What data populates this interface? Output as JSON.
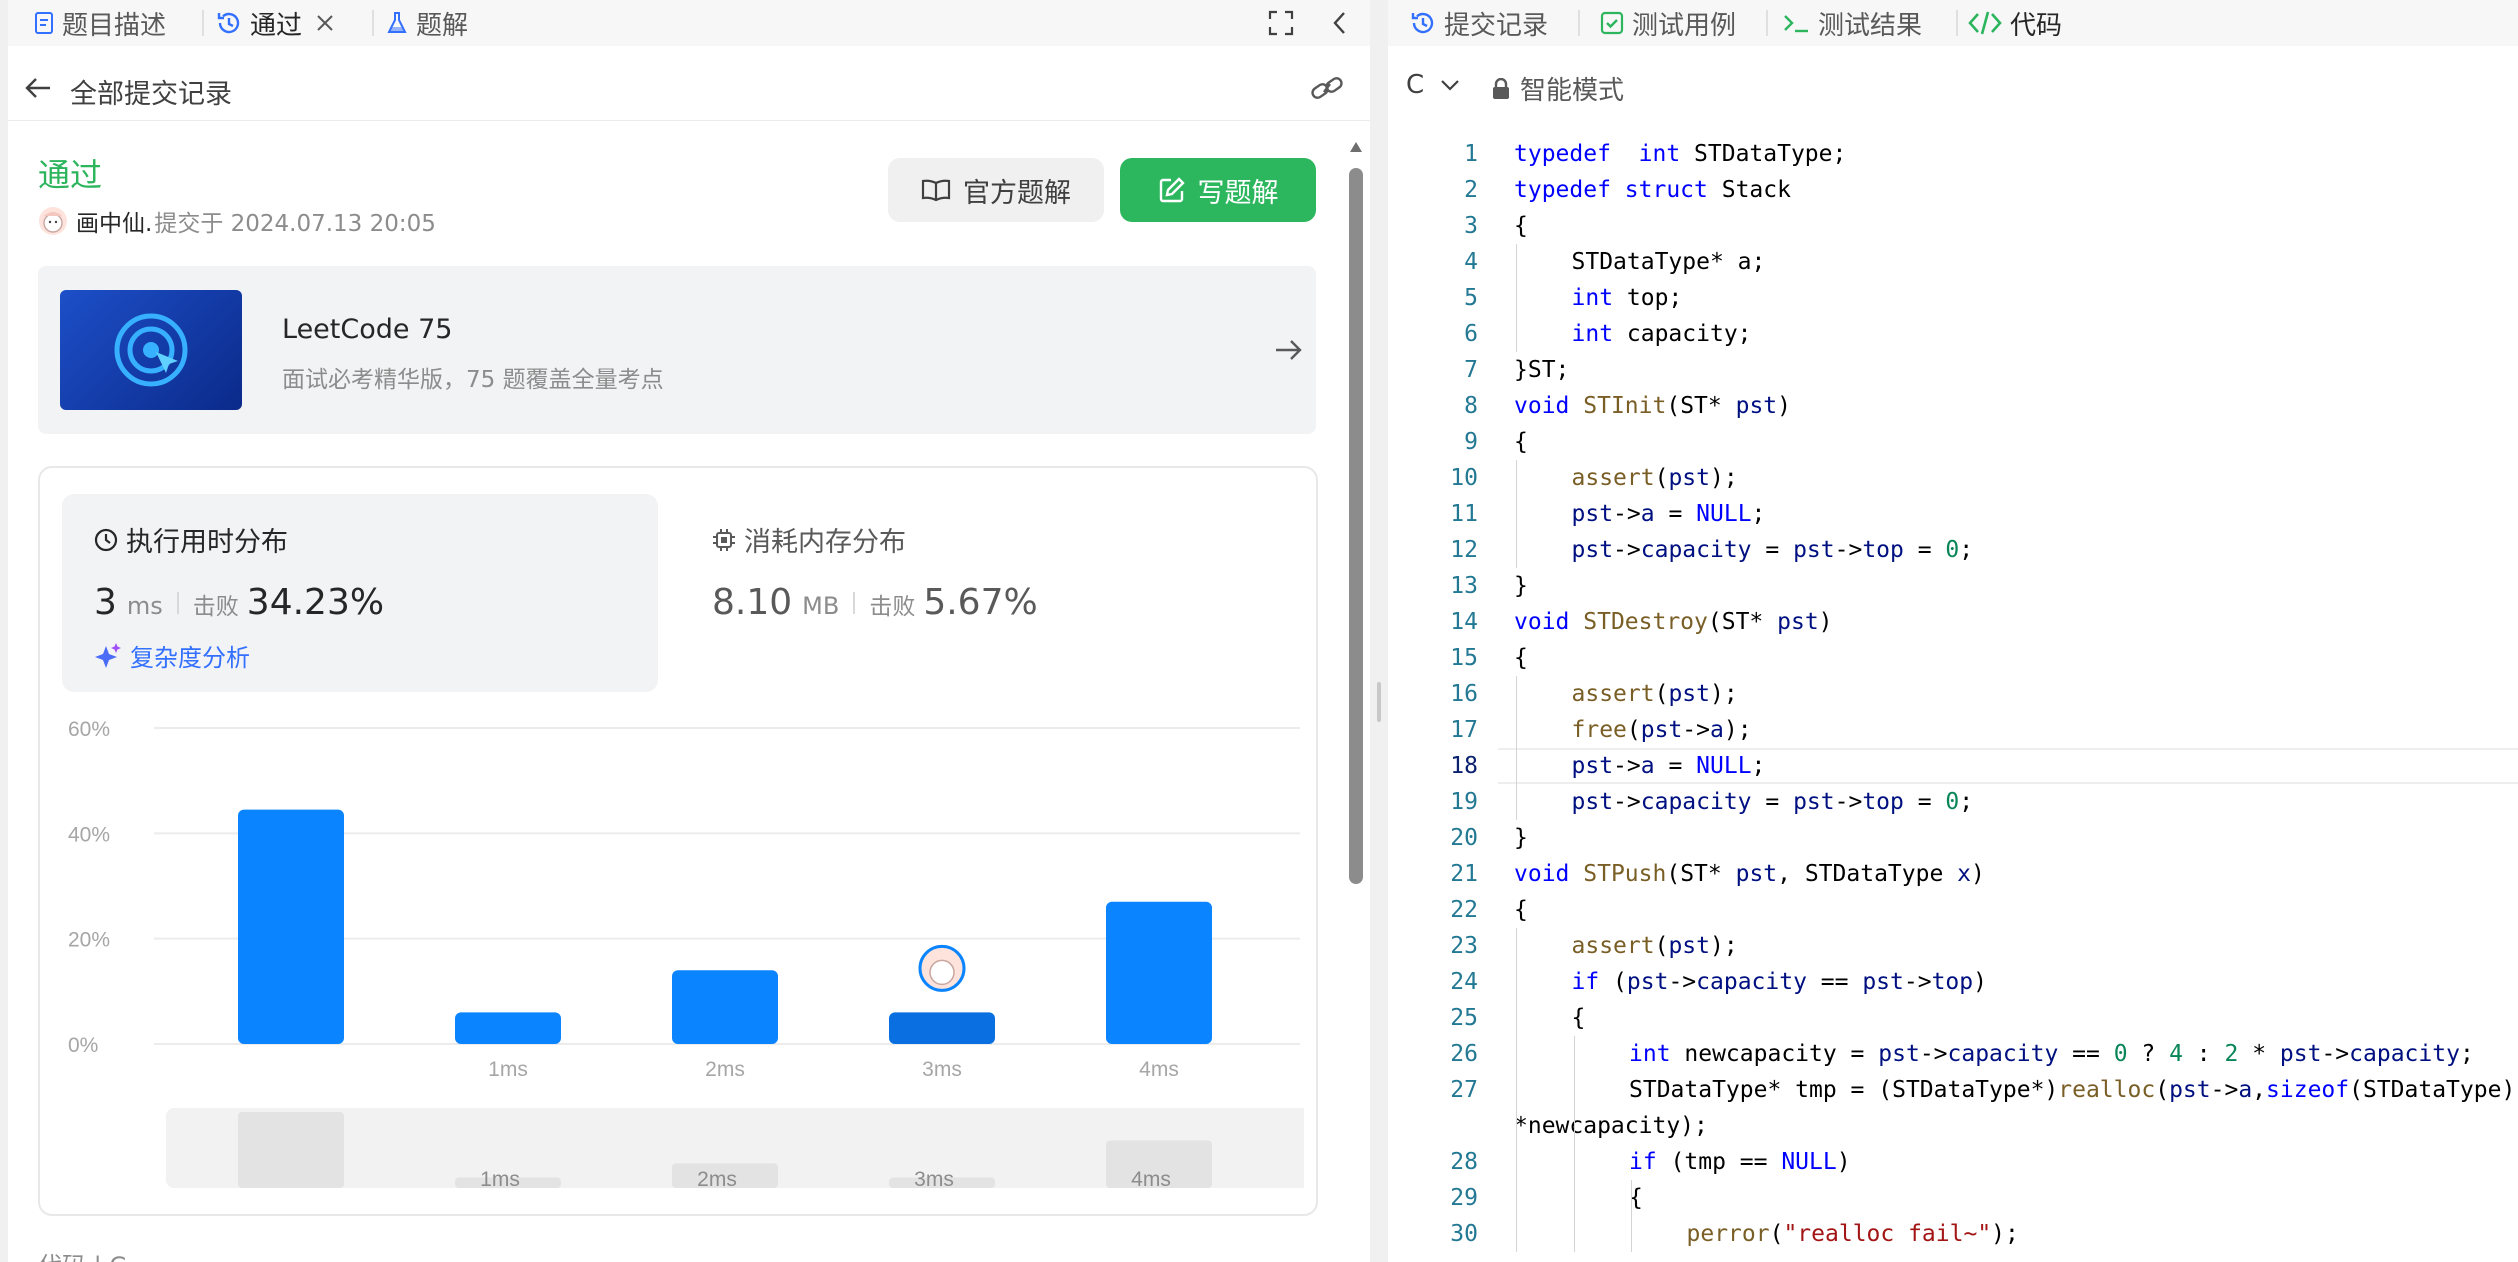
{
  "left_tabs": {
    "description": "题目描述",
    "accepted": "通过",
    "solutions": "题解"
  },
  "submissions_header": "全部提交记录",
  "result": {
    "status": "通过",
    "user": "画中仙.",
    "submitted_at": "提交于 2024.07.13 20:05",
    "official_solution_label": "官方题解",
    "write_solution_label": "写题解"
  },
  "banner": {
    "title": "LeetCode 75",
    "subtitle": "面试必考精华版，75 题覆盖全量考点"
  },
  "runtime": {
    "title": "执行用时分布",
    "value": "3",
    "unit": "ms",
    "beat_label": "击败",
    "beat": "34.23%",
    "complexity_link": "复杂度分析"
  },
  "memory": {
    "title": "消耗内存分布",
    "value": "8.10",
    "unit": "MB",
    "beat_label": "击败",
    "beat": "5.67%"
  },
  "chart_data": {
    "type": "bar",
    "categories": [
      "",
      "1ms",
      "2ms",
      "3ms",
      "4ms"
    ],
    "values": [
      44.5,
      6,
      14,
      6,
      27
    ],
    "highlight_index": 3,
    "y_ticks": [
      "60%",
      "40%",
      "20%",
      "0%"
    ],
    "ylim": [
      0,
      60
    ],
    "grid": true,
    "colors": {
      "bar": "#0a84ff",
      "highlight": "#0a6fe0",
      "brush": "#e3e3e3"
    }
  },
  "footer_partial": "代码 | C",
  "right_tabs": {
    "submissions": "提交记录",
    "testcases": "测试用例",
    "test_results": "测试结果",
    "code": "代码"
  },
  "editor": {
    "language": "C",
    "mode": "智能模式",
    "active_line": 18
  },
  "code_lines": [
    {
      "n": "1",
      "i": 0,
      "t": [
        [
          "kw",
          "typedef"
        ],
        [
          "",
          "  "
        ],
        [
          "kw",
          "int"
        ],
        [
          "",
          " STDataType;"
        ]
      ]
    },
    {
      "n": "2",
      "i": 0,
      "t": [
        [
          "kw",
          "typedef"
        ],
        [
          "",
          " "
        ],
        [
          "kw",
          "struct"
        ],
        [
          "",
          " Stack"
        ]
      ]
    },
    {
      "n": "3",
      "i": 0,
      "t": [
        [
          "",
          "{"
        ]
      ]
    },
    {
      "n": "4",
      "i": 1,
      "t": [
        [
          "",
          "STDataType* a;"
        ]
      ]
    },
    {
      "n": "5",
      "i": 1,
      "t": [
        [
          "kw",
          "int"
        ],
        [
          "",
          " top;"
        ]
      ]
    },
    {
      "n": "6",
      "i": 1,
      "t": [
        [
          "kw",
          "int"
        ],
        [
          "",
          " capacity;"
        ]
      ]
    },
    {
      "n": "7",
      "i": 0,
      "t": [
        [
          "",
          "}ST;"
        ]
      ]
    },
    {
      "n": "8",
      "i": 0,
      "t": [
        [
          "kw",
          "void"
        ],
        [
          "",
          " "
        ],
        [
          "fn",
          "STInit"
        ],
        [
          "",
          "(ST* "
        ],
        [
          "pm",
          "pst"
        ],
        [
          "",
          ")"
        ]
      ]
    },
    {
      "n": "9",
      "i": 0,
      "t": [
        [
          "",
          "{"
        ]
      ]
    },
    {
      "n": "10",
      "i": 1,
      "t": [
        [
          "fn",
          "assert"
        ],
        [
          "",
          "("
        ],
        [
          "pm",
          "pst"
        ],
        [
          "",
          ");"
        ]
      ]
    },
    {
      "n": "11",
      "i": 1,
      "t": [
        [
          "pm",
          "pst"
        ],
        [
          "",
          "->"
        ],
        [
          "pm",
          "a"
        ],
        [
          "",
          " = "
        ],
        [
          "kw",
          "NULL"
        ],
        [
          "",
          ";"
        ]
      ]
    },
    {
      "n": "12",
      "i": 1,
      "t": [
        [
          "pm",
          "pst"
        ],
        [
          "",
          "->"
        ],
        [
          "pm",
          "capacity"
        ],
        [
          "",
          " = "
        ],
        [
          "pm",
          "pst"
        ],
        [
          "",
          "->"
        ],
        [
          "pm",
          "top"
        ],
        [
          "",
          " = "
        ],
        [
          "nm",
          "0"
        ],
        [
          "",
          ";"
        ]
      ]
    },
    {
      "n": "13",
      "i": 0,
      "t": [
        [
          "",
          "}"
        ]
      ]
    },
    {
      "n": "14",
      "i": 0,
      "t": [
        [
          "kw",
          "void"
        ],
        [
          "",
          " "
        ],
        [
          "fn",
          "STDestroy"
        ],
        [
          "",
          "(ST* "
        ],
        [
          "pm",
          "pst"
        ],
        [
          "",
          ")"
        ]
      ]
    },
    {
      "n": "15",
      "i": 0,
      "t": [
        [
          "",
          "{"
        ]
      ]
    },
    {
      "n": "16",
      "i": 1,
      "t": [
        [
          "fn",
          "assert"
        ],
        [
          "",
          "("
        ],
        [
          "pm",
          "pst"
        ],
        [
          "",
          ");"
        ]
      ]
    },
    {
      "n": "17",
      "i": 1,
      "t": [
        [
          "fn",
          "free"
        ],
        [
          "",
          "("
        ],
        [
          "pm",
          "pst"
        ],
        [
          "",
          "->"
        ],
        [
          "pm",
          "a"
        ],
        [
          "",
          ");"
        ]
      ]
    },
    {
      "n": "18",
      "i": 1,
      "t": [
        [
          "pm",
          "pst"
        ],
        [
          "",
          "->"
        ],
        [
          "pm",
          "a"
        ],
        [
          "",
          " = "
        ],
        [
          "kw",
          "NULL"
        ],
        [
          "",
          ";"
        ]
      ]
    },
    {
      "n": "19",
      "i": 1,
      "t": [
        [
          "pm",
          "pst"
        ],
        [
          "",
          "->"
        ],
        [
          "pm",
          "capacity"
        ],
        [
          "",
          " = "
        ],
        [
          "pm",
          "pst"
        ],
        [
          "",
          "->"
        ],
        [
          "pm",
          "top"
        ],
        [
          "",
          " = "
        ],
        [
          "nm",
          "0"
        ],
        [
          "",
          ";"
        ]
      ]
    },
    {
      "n": "20",
      "i": 0,
      "t": [
        [
          "",
          "}"
        ]
      ]
    },
    {
      "n": "21",
      "i": 0,
      "t": [
        [
          "kw",
          "void"
        ],
        [
          "",
          " "
        ],
        [
          "fn",
          "STPush"
        ],
        [
          "",
          "(ST* "
        ],
        [
          "pm",
          "pst"
        ],
        [
          "",
          ", STDataType "
        ],
        [
          "pm",
          "x"
        ],
        [
          "",
          ")"
        ]
      ]
    },
    {
      "n": "22",
      "i": 0,
      "t": [
        [
          "",
          "{"
        ]
      ]
    },
    {
      "n": "23",
      "i": 1,
      "t": [
        [
          "fn",
          "assert"
        ],
        [
          "",
          "("
        ],
        [
          "pm",
          "pst"
        ],
        [
          "",
          ");"
        ]
      ]
    },
    {
      "n": "24",
      "i": 1,
      "t": [
        [
          "kw",
          "if"
        ],
        [
          "",
          " ("
        ],
        [
          "pm",
          "pst"
        ],
        [
          "",
          "->"
        ],
        [
          "pm",
          "capacity"
        ],
        [
          "",
          " == "
        ],
        [
          "pm",
          "pst"
        ],
        [
          "",
          "->"
        ],
        [
          "pm",
          "top"
        ],
        [
          "",
          ")"
        ]
      ]
    },
    {
      "n": "25",
      "i": 1,
      "t": [
        [
          "",
          "{"
        ]
      ]
    },
    {
      "n": "26",
      "i": 2,
      "t": [
        [
          "kw",
          "int"
        ],
        [
          "",
          " newcapacity = "
        ],
        [
          "pm",
          "pst"
        ],
        [
          "",
          "->"
        ],
        [
          "pm",
          "capacity"
        ],
        [
          "",
          " == "
        ],
        [
          "nm",
          "0"
        ],
        [
          "",
          " ? "
        ],
        [
          "nm",
          "4"
        ],
        [
          "",
          " : "
        ],
        [
          "nm",
          "2"
        ],
        [
          "",
          " * "
        ],
        [
          "pm",
          "pst"
        ],
        [
          "",
          "->"
        ],
        [
          "pm",
          "capacity"
        ],
        [
          "",
          ";"
        ]
      ]
    },
    {
      "n": "27",
      "i": 2,
      "t": [
        [
          "",
          "STDataType* tmp = (STDataType*)"
        ],
        [
          "fn",
          "realloc"
        ],
        [
          "",
          "("
        ],
        [
          "pm",
          "pst"
        ],
        [
          "",
          "->"
        ],
        [
          "pm",
          "a"
        ],
        [
          "",
          ","
        ],
        [
          "kw",
          "sizeof"
        ],
        [
          "",
          "(STDataType)"
        ]
      ]
    },
    {
      "n": "",
      "i": 0,
      "t": [
        [
          "",
          "*newcapacity);"
        ]
      ]
    },
    {
      "n": "28",
      "i": 2,
      "t": [
        [
          "kw",
          "if"
        ],
        [
          "",
          " (tmp == "
        ],
        [
          "kw",
          "NULL"
        ],
        [
          "",
          ")"
        ]
      ]
    },
    {
      "n": "29",
      "i": 2,
      "t": [
        [
          "",
          "{"
        ]
      ]
    },
    {
      "n": "30",
      "i": 3,
      "t": [
        [
          "fn",
          "perror"
        ],
        [
          "",
          "("
        ],
        [
          "st",
          "\"realloc fail~\""
        ],
        [
          "",
          ");"
        ]
      ]
    }
  ]
}
